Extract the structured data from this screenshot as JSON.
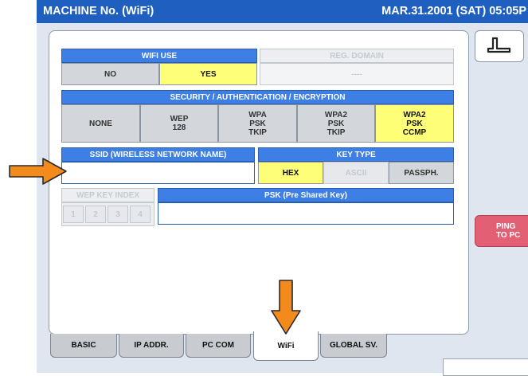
{
  "header": {
    "title": "MACHINE No. (WiFi)",
    "datetime": "MAR.31.2001 (SAT)  05:05P"
  },
  "wifi_use": {
    "label": "WIFI USE",
    "options": [
      "NO",
      "YES"
    ],
    "selected": "YES"
  },
  "reg_domain": {
    "label": "REG. DOMAIN",
    "value": "----"
  },
  "security": {
    "label": "SECURITY / AUTHENTICATION / ENCRYPTION",
    "options": [
      {
        "line1": "NONE",
        "line2": "",
        "line3": ""
      },
      {
        "line1": "WEP",
        "line2": "128",
        "line3": ""
      },
      {
        "line1": "WPA",
        "line2": "PSK",
        "line3": "TKIP"
      },
      {
        "line1": "WPA2",
        "line2": "PSK",
        "line3": "TKIP"
      },
      {
        "line1": "WPA2",
        "line2": "PSK",
        "line3": "CCMP"
      }
    ],
    "selected": "WPA2 PSK CCMP"
  },
  "ssid": {
    "label": "SSID (WIRELESS NETWORK NAME)",
    "value": ""
  },
  "key_type": {
    "label": "KEY TYPE",
    "options": [
      "HEX",
      "ASCII",
      "PASSPH."
    ],
    "selected": "HEX"
  },
  "wep_key_index": {
    "label": "WEP KEY INDEX",
    "options": [
      "1",
      "2",
      "3",
      "4"
    ]
  },
  "psk": {
    "label": "PSK (Pre Shared Key)",
    "value": ""
  },
  "ping_button": {
    "line1": "PING",
    "line2": "TO PC"
  },
  "tabs": [
    "BASIC",
    "IP ADDR.",
    "PC COM",
    "WiFi",
    "GLOBAL SV."
  ],
  "active_tab": "WiFi",
  "colors": {
    "title_bar": "#1f5fbf",
    "header_blue": "#3d7fe4",
    "selected": "#ffff77",
    "arrow": "#f28a1c",
    "ping": "#e35f74"
  }
}
